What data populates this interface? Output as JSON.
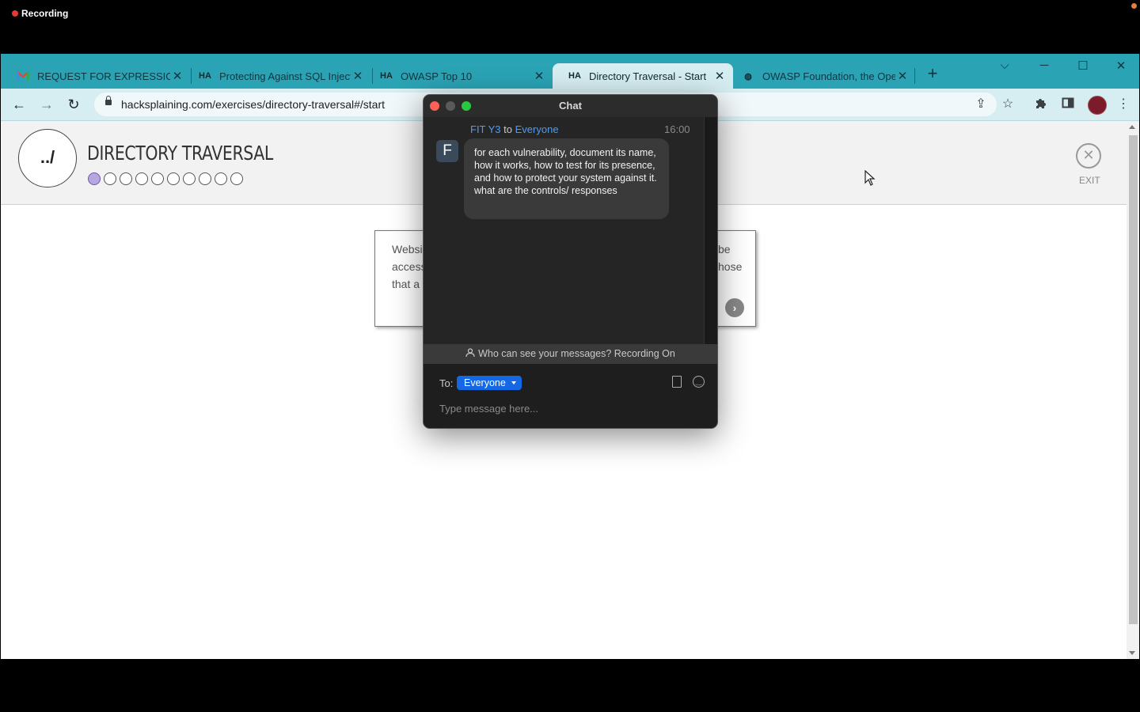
{
  "recording": {
    "label": "Recording"
  },
  "tabs": [
    {
      "title": "REQUEST FOR EXPRESSION OF",
      "favicon": "gmail-icon"
    },
    {
      "title": "Protecting Against SQL Injection",
      "favicon": "hacksplaining-icon"
    },
    {
      "title": "OWASP Top 10",
      "favicon": "hacksplaining-icon"
    },
    {
      "title": "Directory Traversal - Start",
      "favicon": "hacksplaining-icon",
      "active": true
    },
    {
      "title": "OWASP Foundation, the Open",
      "favicon": "owasp-icon"
    }
  ],
  "favicon_glyphs": {
    "hacksplaining": "HA",
    "owasp": "◍",
    "gmail": "M"
  },
  "address": {
    "url": "hacksplaining.com/exercises/directory-traversal#/start"
  },
  "page": {
    "logo": "../",
    "course_title": "DIRECTORY TRAVERSAL",
    "progress": {
      "completed": 1,
      "total": 10
    },
    "exit_label": "EXIT",
    "card": {
      "left_lines": [
        "Websi",
        "access",
        "that a"
      ],
      "right_lines": [
        "be",
        "hose"
      ]
    }
  },
  "chat": {
    "title": "Chat",
    "message": {
      "sender": "FIT Y3",
      "to_word": "to",
      "recipient": "Everyone",
      "time": "16:00",
      "avatar_letter": "F",
      "text": "for each vulnerability, document its name, how it works, how to test for its presence, and how to protect your system against it. what are the controls/ responses"
    },
    "visibility_text": "Who can see your messages? Recording On",
    "to_label": "To:",
    "to_value": "Everyone",
    "input_placeholder": "Type message here..."
  },
  "colors": {
    "tabstrip": "#2aa3b5",
    "toolbar": "#d6eef2",
    "chat_accent": "#1468e3",
    "progress_done": "#b7a6e0"
  }
}
